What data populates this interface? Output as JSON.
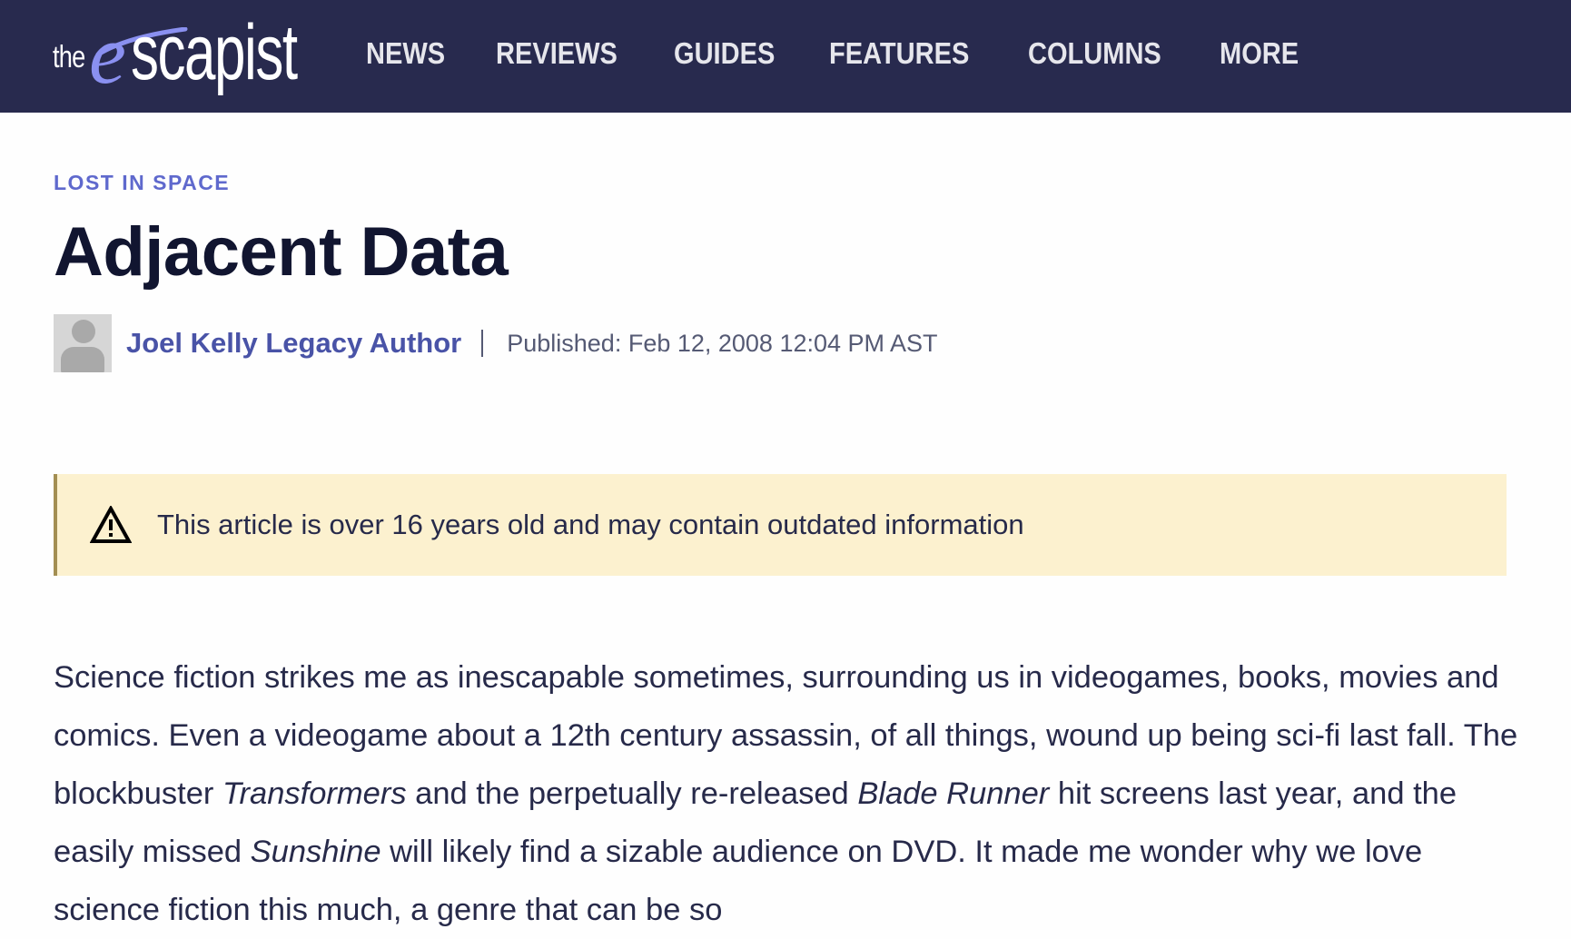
{
  "header": {
    "logo": {
      "prefix": "the",
      "e": "e",
      "rest": "scapist",
      "accent_color": "#8a90f0"
    },
    "nav": [
      {
        "label": "NEWS"
      },
      {
        "label": "REVIEWS"
      },
      {
        "label": "GUIDES"
      },
      {
        "label": "FEATURES"
      },
      {
        "label": "COLUMNS"
      },
      {
        "label": "MORE"
      }
    ],
    "background_color": "#282a4e"
  },
  "article": {
    "category": "LOST IN SPACE",
    "title": "Adjacent Data",
    "author": "Joel Kelly Legacy Author",
    "avatar_icon": "user-silhouette-icon",
    "published": "Published: Feb 12, 2008 12:04 PM AST",
    "notice": {
      "icon": "warning-triangle-icon",
      "text": "This article is over 16 years old and may contain outdated information",
      "background_color": "#fcf1cf"
    },
    "body": {
      "s1": "Science fiction strikes me as inescapable sometimes, surrounding us in videogames, books, movies and comics. Even a videogame about a 12th century assassin, of all things, wound up being sci-fi last fall. The blockbuster ",
      "i1": "Transformers",
      "s2": " and the perpetually re-released ",
      "i2": "Blade Runner",
      "s3": " hit screens last year, and the easily missed ",
      "i3": "Sunshine",
      "s4": " will likely find a sizable audience on DVD. It made me wonder why we love science fiction this much, a genre that can be so"
    }
  }
}
